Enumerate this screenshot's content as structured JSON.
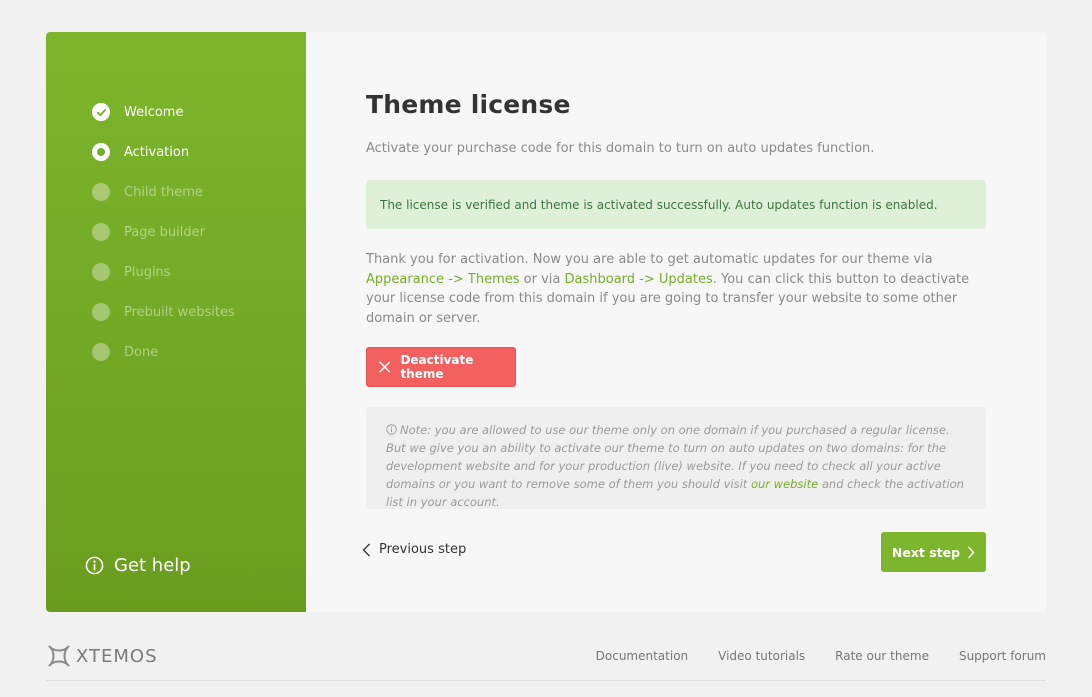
{
  "sidebar": {
    "steps": [
      {
        "label": "Welcome",
        "state": "done"
      },
      {
        "label": "Activation",
        "state": "active"
      },
      {
        "label": "Child theme",
        "state": "pending"
      },
      {
        "label": "Page builder",
        "state": "pending"
      },
      {
        "label": "Plugins",
        "state": "pending"
      },
      {
        "label": "Prebuilt websites",
        "state": "pending"
      },
      {
        "label": "Done",
        "state": "pending"
      }
    ],
    "help_label": "Get help"
  },
  "main": {
    "title": "Theme license",
    "subtitle": "Activate your purchase code for this domain to turn on auto updates function.",
    "success_message": "The license is verified and theme is activated successfully. Auto updates function is enabled.",
    "info": {
      "part1": "Thank you for activation. Now you are able to get automatic updates for our theme via ",
      "link1": "Appearance -> Themes",
      "part2": " or via ",
      "link2": "Dashboard -> Updates",
      "part3": ". You can click this button to deactivate your license code from this domain if you are going to transfer your website to some other domain or server."
    },
    "deactivate_label": "Deactivate theme",
    "note": {
      "part1": "Note: you are allowed to use our theme only on one domain if you purchased a regular license. But we give you an ability to activate our theme to turn on auto updates on two domains: for the development website and for your production (live) website. If you need to check all your active domains or you want to remove some of them you should visit ",
      "link": "our website",
      "part2": " and check the activation list in your account."
    },
    "prev_label": "Previous step",
    "next_label": "Next step"
  },
  "footer": {
    "logo_text": "XTEMOS",
    "links": [
      "Documentation",
      "Video tutorials",
      "Rate our theme",
      "Support forum"
    ]
  },
  "colors": {
    "accent": "#7db52c",
    "danger": "#f26060",
    "success_bg": "#dff0d8",
    "success_text": "#3c763d"
  }
}
